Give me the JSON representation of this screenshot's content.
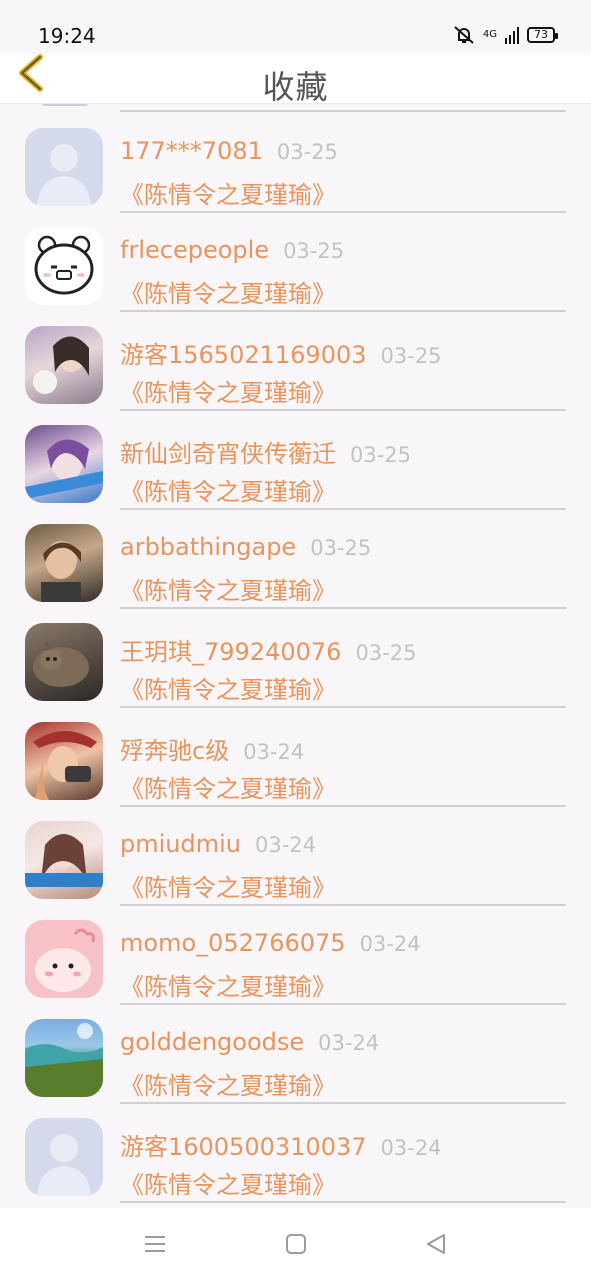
{
  "status_bar": {
    "time": "19:24",
    "network": "4G",
    "battery": "73"
  },
  "header": {
    "title": "收藏"
  },
  "colors": {
    "accent": "#e8945c",
    "date": "#c2c2c2",
    "back_chevron": "#e3b52b"
  },
  "items": [
    {
      "name": "177***7081",
      "date": "03-25",
      "title": "《陈情令之夏瑾瑜》",
      "avatar": "default-avatar"
    },
    {
      "name": "frlecepeople",
      "date": "03-25",
      "title": "《陈情令之夏瑾瑜》",
      "avatar": "bear-avatar"
    },
    {
      "name": "游客1565021169003",
      "date": "03-25",
      "title": "《陈情令之夏瑾瑜》",
      "avatar": "photo-avatar"
    },
    {
      "name": "新仙剑奇宵侠传蘅迁",
      "date": "03-25",
      "title": "《陈情令之夏瑾瑜》",
      "avatar": "photo-avatar"
    },
    {
      "name": "arbbathingape",
      "date": "03-25",
      "title": "《陈情令之夏瑾瑜》",
      "avatar": "photo-avatar"
    },
    {
      "name": "王玥琪_799240076",
      "date": "03-25",
      "title": "《陈情令之夏瑾瑜》",
      "avatar": "cat-avatar"
    },
    {
      "name": "殍奔驰c级",
      "date": "03-24",
      "title": "《陈情令之夏瑾瑜》",
      "avatar": "photo-avatar"
    },
    {
      "name": "pmiudmiu",
      "date": "03-24",
      "title": "《陈情令之夏瑾瑜》",
      "avatar": "photo-avatar"
    },
    {
      "name": "momo_052766075",
      "date": "03-24",
      "title": "《陈情令之夏瑾瑜》",
      "avatar": "pink-cartoon-avatar"
    },
    {
      "name": "golddengoodse",
      "date": "03-24",
      "title": "《陈情令之夏瑾瑜》",
      "avatar": "landscape-avatar"
    },
    {
      "name": "游客1600500310037",
      "date": "03-24",
      "title": "《陈情令之夏瑾瑜》",
      "avatar": "default-avatar"
    }
  ],
  "nav": {
    "icons": [
      "menu-icon",
      "home-icon",
      "back-triangle-icon"
    ]
  }
}
